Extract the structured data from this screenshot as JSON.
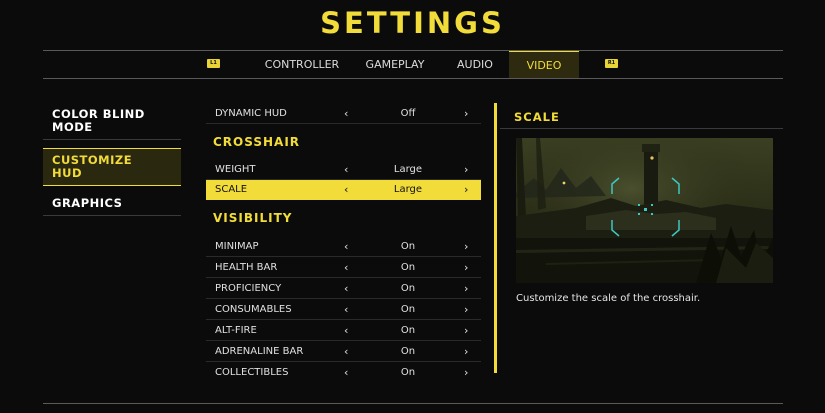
{
  "title": "SETTINGS",
  "tabs": {
    "left_hint": "L1",
    "right_hint": "R1",
    "items": [
      {
        "label": "CONTROLLER"
      },
      {
        "label": "GAMEPLAY"
      },
      {
        "label": "AUDIO"
      },
      {
        "label": "VIDEO",
        "active": true
      }
    ]
  },
  "left_menu": {
    "items": [
      {
        "label": "COLOR BLIND MODE"
      },
      {
        "label": "CUSTOMIZE HUD",
        "active": true
      },
      {
        "label": "GRAPHICS"
      }
    ]
  },
  "settings": {
    "dynamic_hud": {
      "label": "DYNAMIC HUD",
      "value": "Off"
    },
    "crosshair_header": "CROSSHAIR",
    "weight": {
      "label": "WEIGHT",
      "value": "Large"
    },
    "scale": {
      "label": "SCALE",
      "value": "Large",
      "selected": true
    },
    "visibility_header": "VISIBILITY",
    "visibility": [
      {
        "label": "MINIMAP",
        "value": "On"
      },
      {
        "label": "HEALTH BAR",
        "value": "On"
      },
      {
        "label": "PROFICIENCY",
        "value": "On"
      },
      {
        "label": "CONSUMABLES",
        "value": "On"
      },
      {
        "label": "ALT-FIRE",
        "value": "On"
      },
      {
        "label": "ADRENALINE BAR",
        "value": "On"
      },
      {
        "label": "COLLECTIBLES",
        "value": "On"
      }
    ],
    "arrow_left": "‹",
    "arrow_right": "›"
  },
  "preview": {
    "title": "SCALE",
    "description": "Customize the scale of the crosshair."
  },
  "colors": {
    "accent": "#f2dc3a",
    "background": "#0b0b0b",
    "reticle": "#3fc7c0"
  }
}
